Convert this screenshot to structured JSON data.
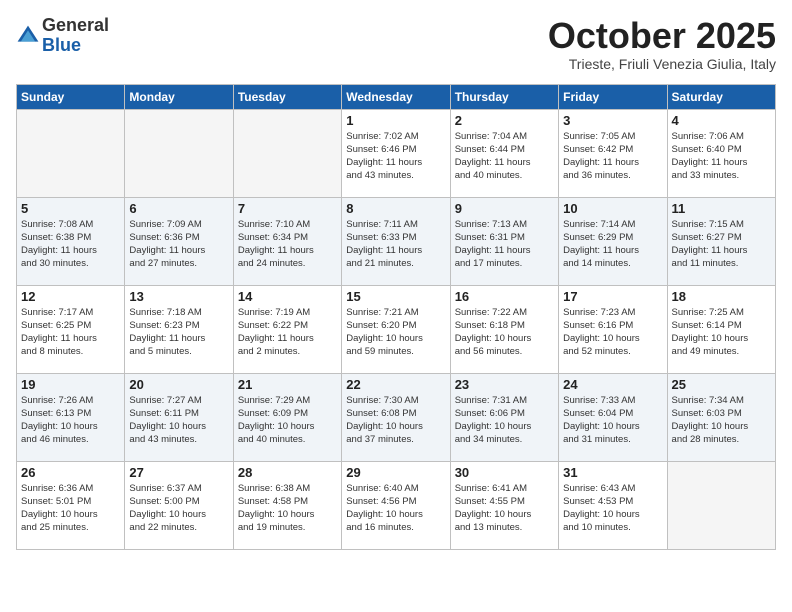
{
  "header": {
    "logo_general": "General",
    "logo_blue": "Blue",
    "month_title": "October 2025",
    "subtitle": "Trieste, Friuli Venezia Giulia, Italy"
  },
  "weekdays": [
    "Sunday",
    "Monday",
    "Tuesday",
    "Wednesday",
    "Thursday",
    "Friday",
    "Saturday"
  ],
  "weeks": [
    [
      {
        "day": "",
        "info": ""
      },
      {
        "day": "",
        "info": ""
      },
      {
        "day": "",
        "info": ""
      },
      {
        "day": "1",
        "info": "Sunrise: 7:02 AM\nSunset: 6:46 PM\nDaylight: 11 hours\nand 43 minutes."
      },
      {
        "day": "2",
        "info": "Sunrise: 7:04 AM\nSunset: 6:44 PM\nDaylight: 11 hours\nand 40 minutes."
      },
      {
        "day": "3",
        "info": "Sunrise: 7:05 AM\nSunset: 6:42 PM\nDaylight: 11 hours\nand 36 minutes."
      },
      {
        "day": "4",
        "info": "Sunrise: 7:06 AM\nSunset: 6:40 PM\nDaylight: 11 hours\nand 33 minutes."
      }
    ],
    [
      {
        "day": "5",
        "info": "Sunrise: 7:08 AM\nSunset: 6:38 PM\nDaylight: 11 hours\nand 30 minutes."
      },
      {
        "day": "6",
        "info": "Sunrise: 7:09 AM\nSunset: 6:36 PM\nDaylight: 11 hours\nand 27 minutes."
      },
      {
        "day": "7",
        "info": "Sunrise: 7:10 AM\nSunset: 6:34 PM\nDaylight: 11 hours\nand 24 minutes."
      },
      {
        "day": "8",
        "info": "Sunrise: 7:11 AM\nSunset: 6:33 PM\nDaylight: 11 hours\nand 21 minutes."
      },
      {
        "day": "9",
        "info": "Sunrise: 7:13 AM\nSunset: 6:31 PM\nDaylight: 11 hours\nand 17 minutes."
      },
      {
        "day": "10",
        "info": "Sunrise: 7:14 AM\nSunset: 6:29 PM\nDaylight: 11 hours\nand 14 minutes."
      },
      {
        "day": "11",
        "info": "Sunrise: 7:15 AM\nSunset: 6:27 PM\nDaylight: 11 hours\nand 11 minutes."
      }
    ],
    [
      {
        "day": "12",
        "info": "Sunrise: 7:17 AM\nSunset: 6:25 PM\nDaylight: 11 hours\nand 8 minutes."
      },
      {
        "day": "13",
        "info": "Sunrise: 7:18 AM\nSunset: 6:23 PM\nDaylight: 11 hours\nand 5 minutes."
      },
      {
        "day": "14",
        "info": "Sunrise: 7:19 AM\nSunset: 6:22 PM\nDaylight: 11 hours\nand 2 minutes."
      },
      {
        "day": "15",
        "info": "Sunrise: 7:21 AM\nSunset: 6:20 PM\nDaylight: 10 hours\nand 59 minutes."
      },
      {
        "day": "16",
        "info": "Sunrise: 7:22 AM\nSunset: 6:18 PM\nDaylight: 10 hours\nand 56 minutes."
      },
      {
        "day": "17",
        "info": "Sunrise: 7:23 AM\nSunset: 6:16 PM\nDaylight: 10 hours\nand 52 minutes."
      },
      {
        "day": "18",
        "info": "Sunrise: 7:25 AM\nSunset: 6:14 PM\nDaylight: 10 hours\nand 49 minutes."
      }
    ],
    [
      {
        "day": "19",
        "info": "Sunrise: 7:26 AM\nSunset: 6:13 PM\nDaylight: 10 hours\nand 46 minutes."
      },
      {
        "day": "20",
        "info": "Sunrise: 7:27 AM\nSunset: 6:11 PM\nDaylight: 10 hours\nand 43 minutes."
      },
      {
        "day": "21",
        "info": "Sunrise: 7:29 AM\nSunset: 6:09 PM\nDaylight: 10 hours\nand 40 minutes."
      },
      {
        "day": "22",
        "info": "Sunrise: 7:30 AM\nSunset: 6:08 PM\nDaylight: 10 hours\nand 37 minutes."
      },
      {
        "day": "23",
        "info": "Sunrise: 7:31 AM\nSunset: 6:06 PM\nDaylight: 10 hours\nand 34 minutes."
      },
      {
        "day": "24",
        "info": "Sunrise: 7:33 AM\nSunset: 6:04 PM\nDaylight: 10 hours\nand 31 minutes."
      },
      {
        "day": "25",
        "info": "Sunrise: 7:34 AM\nSunset: 6:03 PM\nDaylight: 10 hours\nand 28 minutes."
      }
    ],
    [
      {
        "day": "26",
        "info": "Sunrise: 6:36 AM\nSunset: 5:01 PM\nDaylight: 10 hours\nand 25 minutes."
      },
      {
        "day": "27",
        "info": "Sunrise: 6:37 AM\nSunset: 5:00 PM\nDaylight: 10 hours\nand 22 minutes."
      },
      {
        "day": "28",
        "info": "Sunrise: 6:38 AM\nSunset: 4:58 PM\nDaylight: 10 hours\nand 19 minutes."
      },
      {
        "day": "29",
        "info": "Sunrise: 6:40 AM\nSunset: 4:56 PM\nDaylight: 10 hours\nand 16 minutes."
      },
      {
        "day": "30",
        "info": "Sunrise: 6:41 AM\nSunset: 4:55 PM\nDaylight: 10 hours\nand 13 minutes."
      },
      {
        "day": "31",
        "info": "Sunrise: 6:43 AM\nSunset: 4:53 PM\nDaylight: 10 hours\nand 10 minutes."
      },
      {
        "day": "",
        "info": ""
      }
    ]
  ]
}
